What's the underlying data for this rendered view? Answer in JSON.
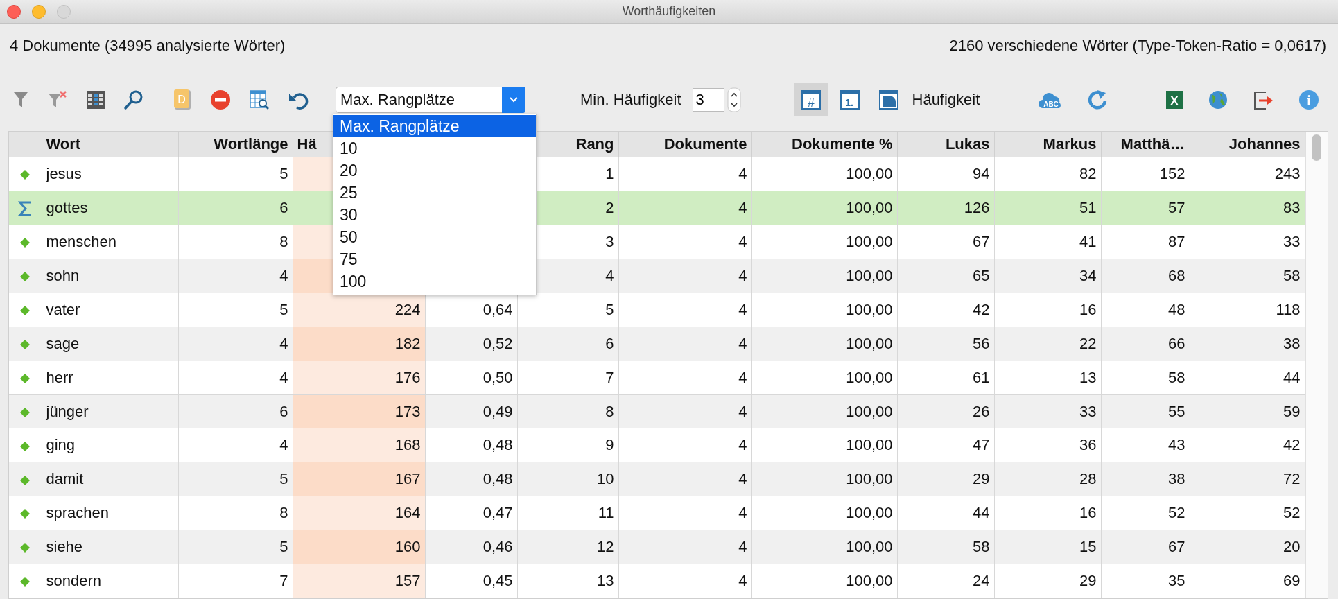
{
  "window": {
    "title": "Worthäufigkeiten"
  },
  "summary": {
    "left": "4 Dokumente (34995 analysierte Wörter)",
    "right": "2160 verschiedene Wörter (Type-Token-Ratio = 0,0617)"
  },
  "toolbar": {
    "left_tools": [
      {
        "kind": "filter"
      },
      {
        "kind": "filter-clear"
      },
      {
        "kind": "columns"
      },
      {
        "kind": "search"
      },
      {
        "kind": "book",
        "glyph": "D"
      },
      {
        "kind": "stop"
      },
      {
        "kind": "table-search"
      },
      {
        "kind": "undo"
      }
    ],
    "rank_select": {
      "value": "Max. Rangplätze",
      "expanded": true,
      "options": [
        {
          "label": "Max. Rangplätze",
          "selected": true
        },
        {
          "label": "10",
          "selected": false
        },
        {
          "label": "20",
          "selected": false
        },
        {
          "label": "25",
          "selected": false
        },
        {
          "label": "30",
          "selected": false
        },
        {
          "label": "50",
          "selected": false
        },
        {
          "label": "75",
          "selected": false
        },
        {
          "label": "100",
          "selected": false
        }
      ]
    },
    "min_label": "Min. Häufigkeit",
    "min_value": "3",
    "view_toggles": [
      {
        "kind": "hash",
        "glyph": "#",
        "selected": true
      },
      {
        "kind": "rank",
        "glyph": "1.",
        "selected": false
      },
      {
        "kind": "doc",
        "selected": false
      }
    ],
    "view_label": "Häufigkeit",
    "right_tools": [
      {
        "kind": "cloud",
        "glyph": "ABC"
      },
      {
        "kind": "refresh"
      },
      {
        "kind": "excel",
        "glyph": "X"
      },
      {
        "kind": "globe"
      },
      {
        "kind": "export"
      },
      {
        "kind": "info",
        "glyph": "i"
      }
    ]
  },
  "table": {
    "columns": [
      {
        "kind": "text",
        "label": "Wort"
      },
      {
        "kind": "number",
        "label": "Wortlänge"
      },
      {
        "kind": "tinted",
        "label": "Hä"
      },
      {
        "kind": "number"
      },
      {
        "kind": "number",
        "label": "Rang"
      },
      {
        "kind": "number",
        "label": "Dokumente"
      },
      {
        "kind": "number",
        "label": "Dokumente %"
      },
      {
        "kind": "number",
        "label": "Lukas"
      },
      {
        "kind": "number",
        "label": "Markus"
      },
      {
        "kind": "number",
        "label": "Matthä…"
      },
      {
        "kind": "number",
        "label": "Johannes"
      }
    ],
    "rows": [
      {
        "kind": "diamond",
        "selected": false,
        "cells": [
          "jesus",
          "5",
          null,
          null,
          "1",
          "4",
          "100,00",
          "94",
          "82",
          "152",
          "243"
        ]
      },
      {
        "kind": "sigma",
        "selected": true,
        "cells": [
          "gottes",
          "6",
          null,
          null,
          "2",
          "4",
          "100,00",
          "126",
          "51",
          "57",
          "83"
        ]
      },
      {
        "kind": "diamond",
        "selected": false,
        "cells": [
          "menschen",
          "8",
          null,
          null,
          "3",
          "4",
          "100,00",
          "67",
          "41",
          "87",
          "33"
        ]
      },
      {
        "kind": "diamond",
        "selected": false,
        "cells": [
          "sohn",
          "4",
          null,
          null,
          "4",
          "4",
          "100,00",
          "65",
          "34",
          "68",
          "58"
        ]
      },
      {
        "kind": "diamond",
        "selected": false,
        "cells": [
          "vater",
          "5",
          "224",
          "0,64",
          "5",
          "4",
          "100,00",
          "42",
          "16",
          "48",
          "118"
        ]
      },
      {
        "kind": "diamond",
        "selected": false,
        "cells": [
          "sage",
          "4",
          "182",
          "0,52",
          "6",
          "4",
          "100,00",
          "56",
          "22",
          "66",
          "38"
        ]
      },
      {
        "kind": "diamond",
        "selected": false,
        "cells": [
          "herr",
          "4",
          "176",
          "0,50",
          "7",
          "4",
          "100,00",
          "61",
          "13",
          "58",
          "44"
        ]
      },
      {
        "kind": "diamond",
        "selected": false,
        "cells": [
          "jünger",
          "6",
          "173",
          "0,49",
          "8",
          "4",
          "100,00",
          "26",
          "33",
          "55",
          "59"
        ]
      },
      {
        "kind": "diamond",
        "selected": false,
        "cells": [
          "ging",
          "4",
          "168",
          "0,48",
          "9",
          "4",
          "100,00",
          "47",
          "36",
          "43",
          "42"
        ]
      },
      {
        "kind": "diamond",
        "selected": false,
        "cells": [
          "damit",
          "5",
          "167",
          "0,48",
          "10",
          "4",
          "100,00",
          "29",
          "28",
          "38",
          "72"
        ]
      },
      {
        "kind": "diamond",
        "selected": false,
        "cells": [
          "sprachen",
          "8",
          "164",
          "0,47",
          "11",
          "4",
          "100,00",
          "44",
          "16",
          "52",
          "52"
        ]
      },
      {
        "kind": "diamond",
        "selected": false,
        "cells": [
          "siehe",
          "5",
          "160",
          "0,46",
          "12",
          "4",
          "100,00",
          "58",
          "15",
          "67",
          "20"
        ]
      },
      {
        "kind": "diamond",
        "selected": false,
        "cells": [
          "sondern",
          "7",
          "157",
          "0,45",
          "13",
          "4",
          "100,00",
          "24",
          "29",
          "35",
          "69"
        ]
      }
    ]
  }
}
